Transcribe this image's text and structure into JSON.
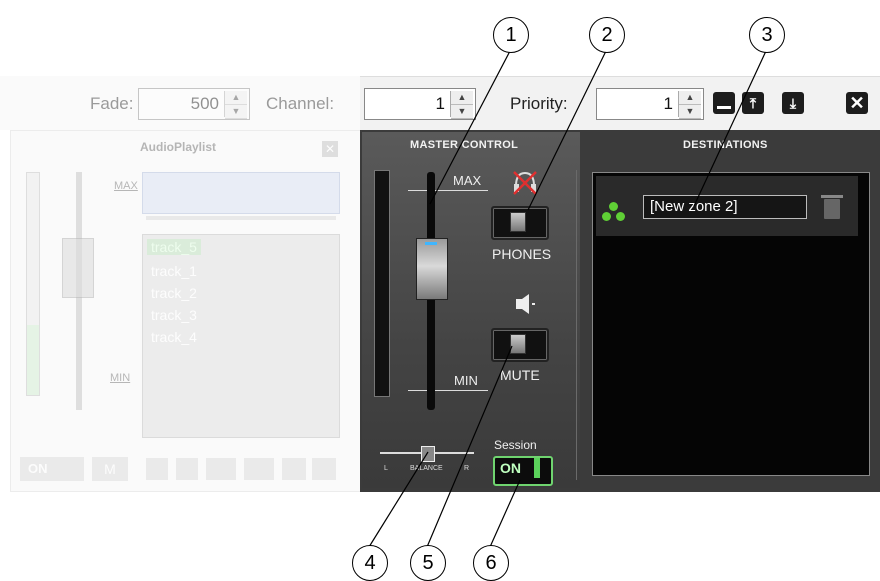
{
  "toolbar": {
    "fade_label": "Fade:",
    "fade_value": "500",
    "channel_label": "Channel:",
    "channel_value": "1",
    "priority_label": "Priority:",
    "priority_value": "1"
  },
  "playlist": {
    "title": "AudioPlaylist",
    "max_label": "MAX",
    "min_label": "MIN",
    "tracks": [
      "track_5",
      "track_1",
      "track_2",
      "track_3",
      "track_4"
    ],
    "on_label": "ON",
    "m_label": "M"
  },
  "master_control": {
    "heading": "MASTER CONTROL",
    "max_label": "MAX",
    "min_label": "MIN",
    "phones_label": "PHONES",
    "mute_label": "MUTE",
    "session_label": "Session",
    "session_on_label": "ON",
    "balance_label": "BALANCE",
    "balance_left": "L",
    "balance_right": "R"
  },
  "destinations": {
    "heading": "DESTINATIONS",
    "zones": [
      "[New zone 2]"
    ]
  },
  "callouts": [
    "1",
    "2",
    "3",
    "4",
    "5",
    "6"
  ],
  "colors": {
    "panel": "#3b3b3b",
    "session_green": "#5bd25b",
    "zone_icon": "#5fcf35",
    "volume_led": "#3fb6ff"
  }
}
